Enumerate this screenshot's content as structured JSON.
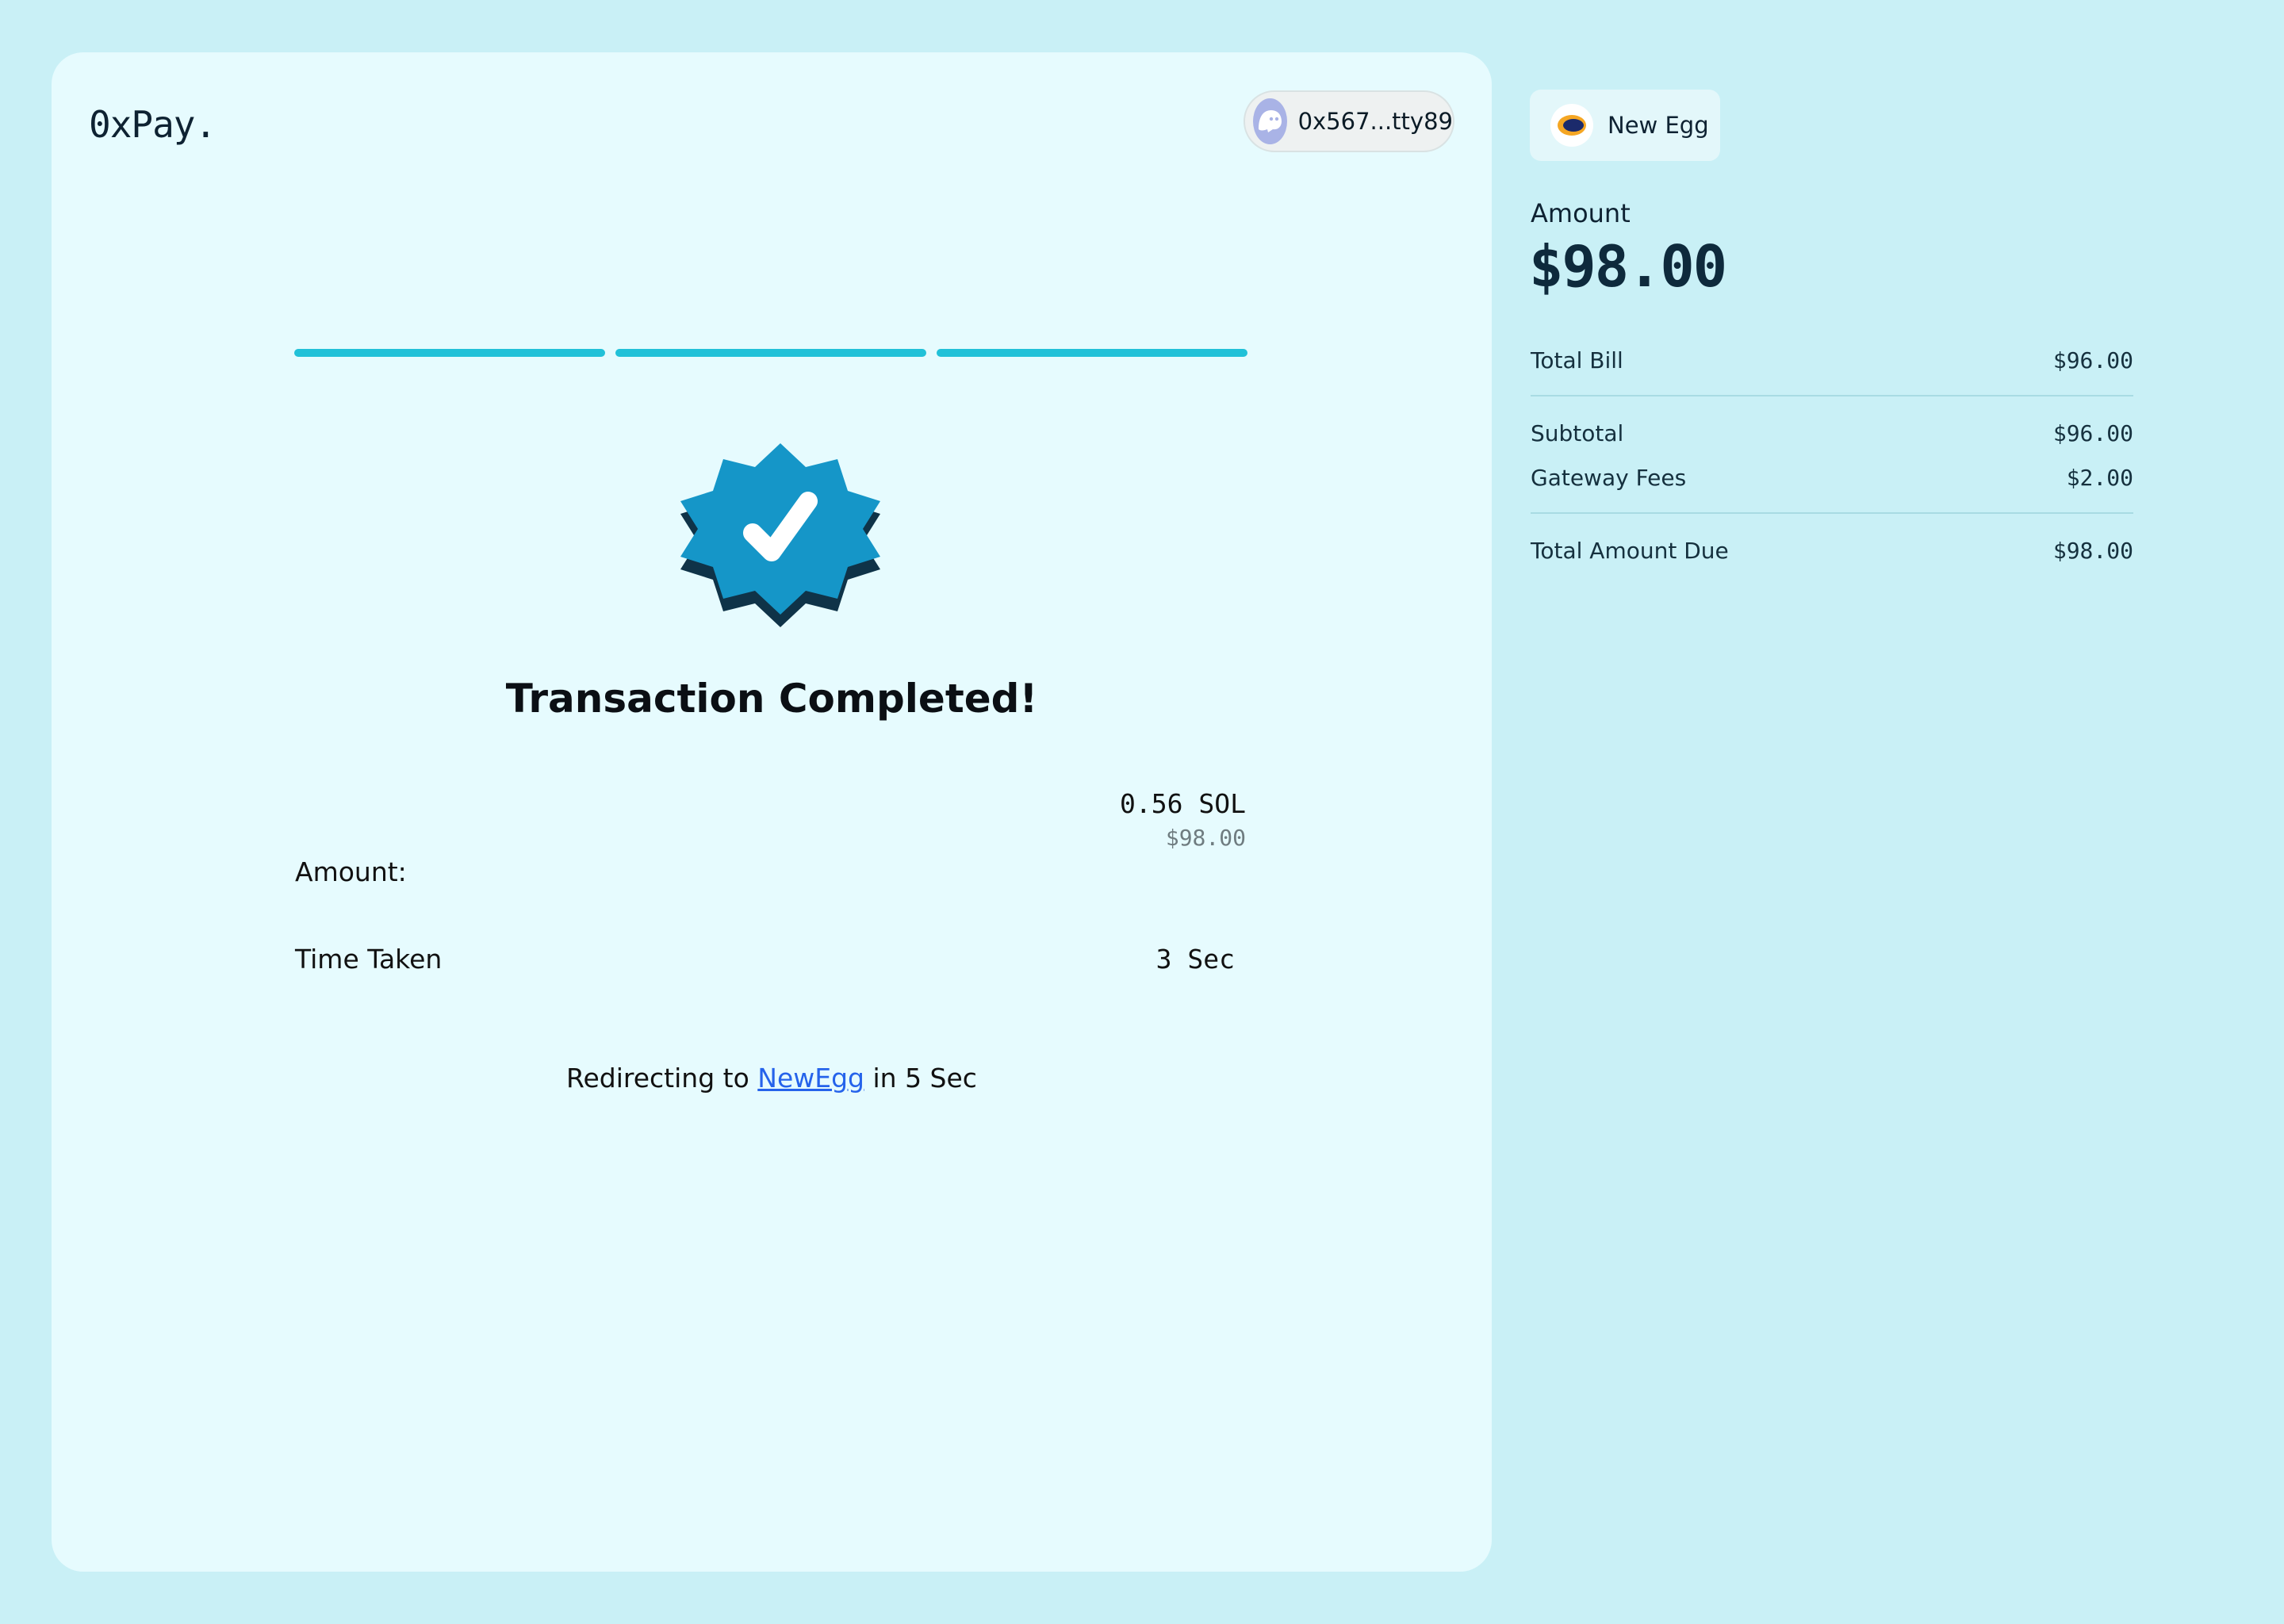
{
  "app": {
    "logo": "0xPay.",
    "wallet_address": "0x567...tty89"
  },
  "progress": {
    "steps_total": 3,
    "steps_completed": 3,
    "color": "#21c1d8"
  },
  "status": {
    "icon": "verified-badge-icon",
    "title": "Transaction Completed!"
  },
  "details": {
    "amount_label": "Amount:",
    "amount_crypto": "0.56 SOL",
    "amount_fiat": "$98.00",
    "time_label": "Time Taken",
    "time_value": "3 Sec"
  },
  "redirect": {
    "prefix": "Redirecting to ",
    "link": "NewEgg",
    "suffix": " in 5 Sec"
  },
  "summary": {
    "merchant_name": "New Egg",
    "amount_label": "Amount",
    "amount_value": "$98.00",
    "total_bill_label": "Total Bill",
    "total_bill_value": "$96.00",
    "subtotal_label": "Subtotal",
    "subtotal_value": "$96.00",
    "fees_label": "Gateway Fees",
    "fees_value": "$2.00",
    "due_label": "Total Amount Due",
    "due_value": "$98.00"
  },
  "colors": {
    "background": "#c9f0f6",
    "card": "#e6fbfe",
    "accent": "#21c1d8",
    "badge": "#1596c8",
    "link": "#2563eb"
  }
}
